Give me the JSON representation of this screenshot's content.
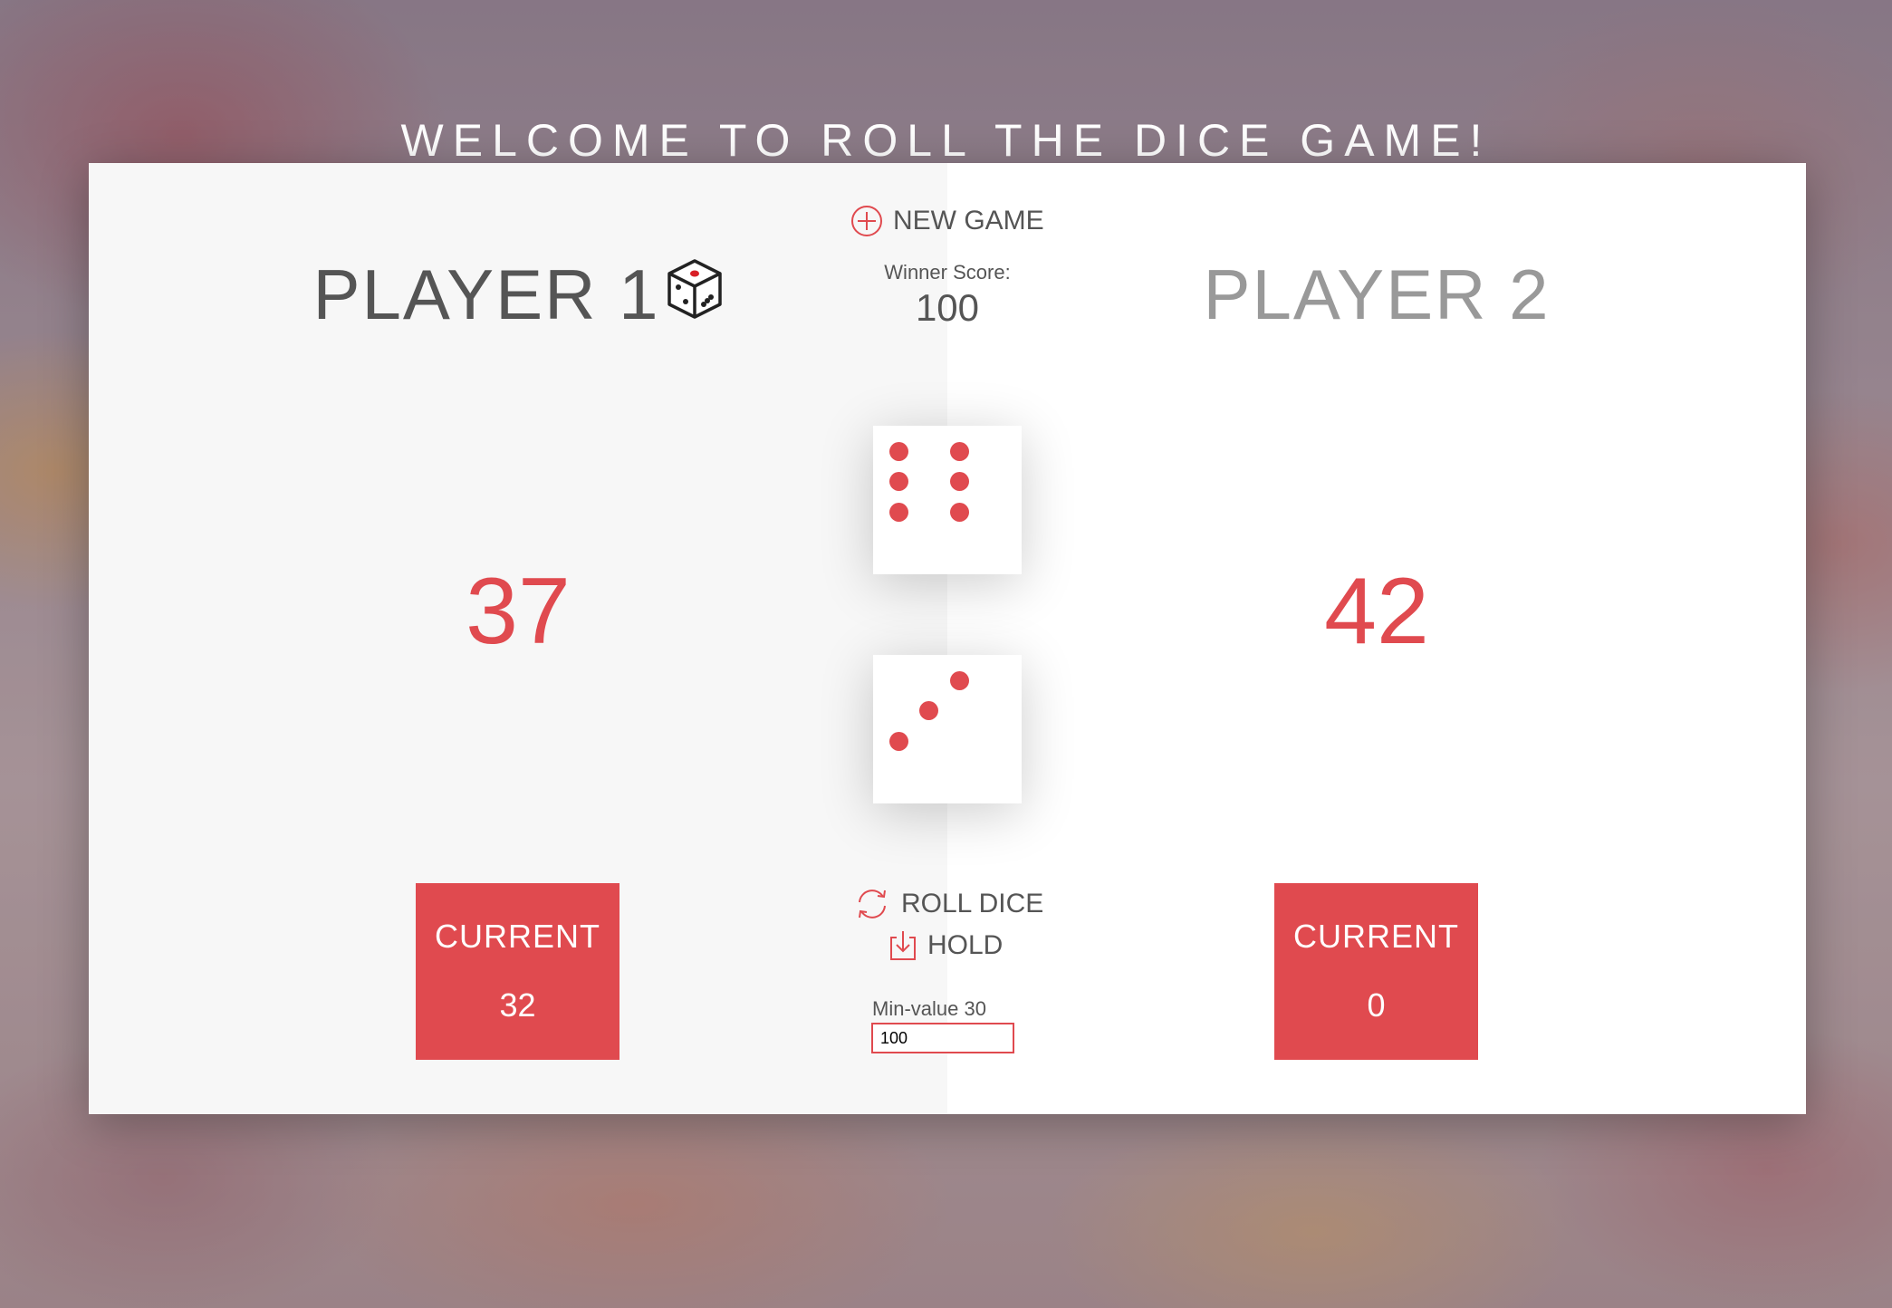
{
  "title": "WELCOME TO ROLL THE DICE GAME!",
  "controls": {
    "new_game_label": "NEW GAME",
    "winner_score_label": "Winner Score:",
    "winner_score_value": "100",
    "roll_dice_label": "ROLL DICE",
    "hold_label": "HOLD",
    "min_value_label": "Min-value 30",
    "min_value_input": "100"
  },
  "players": [
    {
      "name": "PLAYER 1",
      "active": true,
      "score": "37",
      "current_label": "CURRENT",
      "current_score": "32"
    },
    {
      "name": "PLAYER 2",
      "active": false,
      "score": "42",
      "current_label": "CURRENT",
      "current_score": "0"
    }
  ],
  "dice": [
    6,
    3
  ],
  "colors": {
    "accent": "#e04a4f",
    "text": "#555555",
    "inactive_text": "#999999",
    "panel_left": "#f7f7f7",
    "panel_right": "#ffffff"
  },
  "icons": {
    "new_game": "plus-circle-icon",
    "roll_dice": "refresh-icon",
    "hold": "download-icon",
    "active_player": "dice-icon"
  }
}
